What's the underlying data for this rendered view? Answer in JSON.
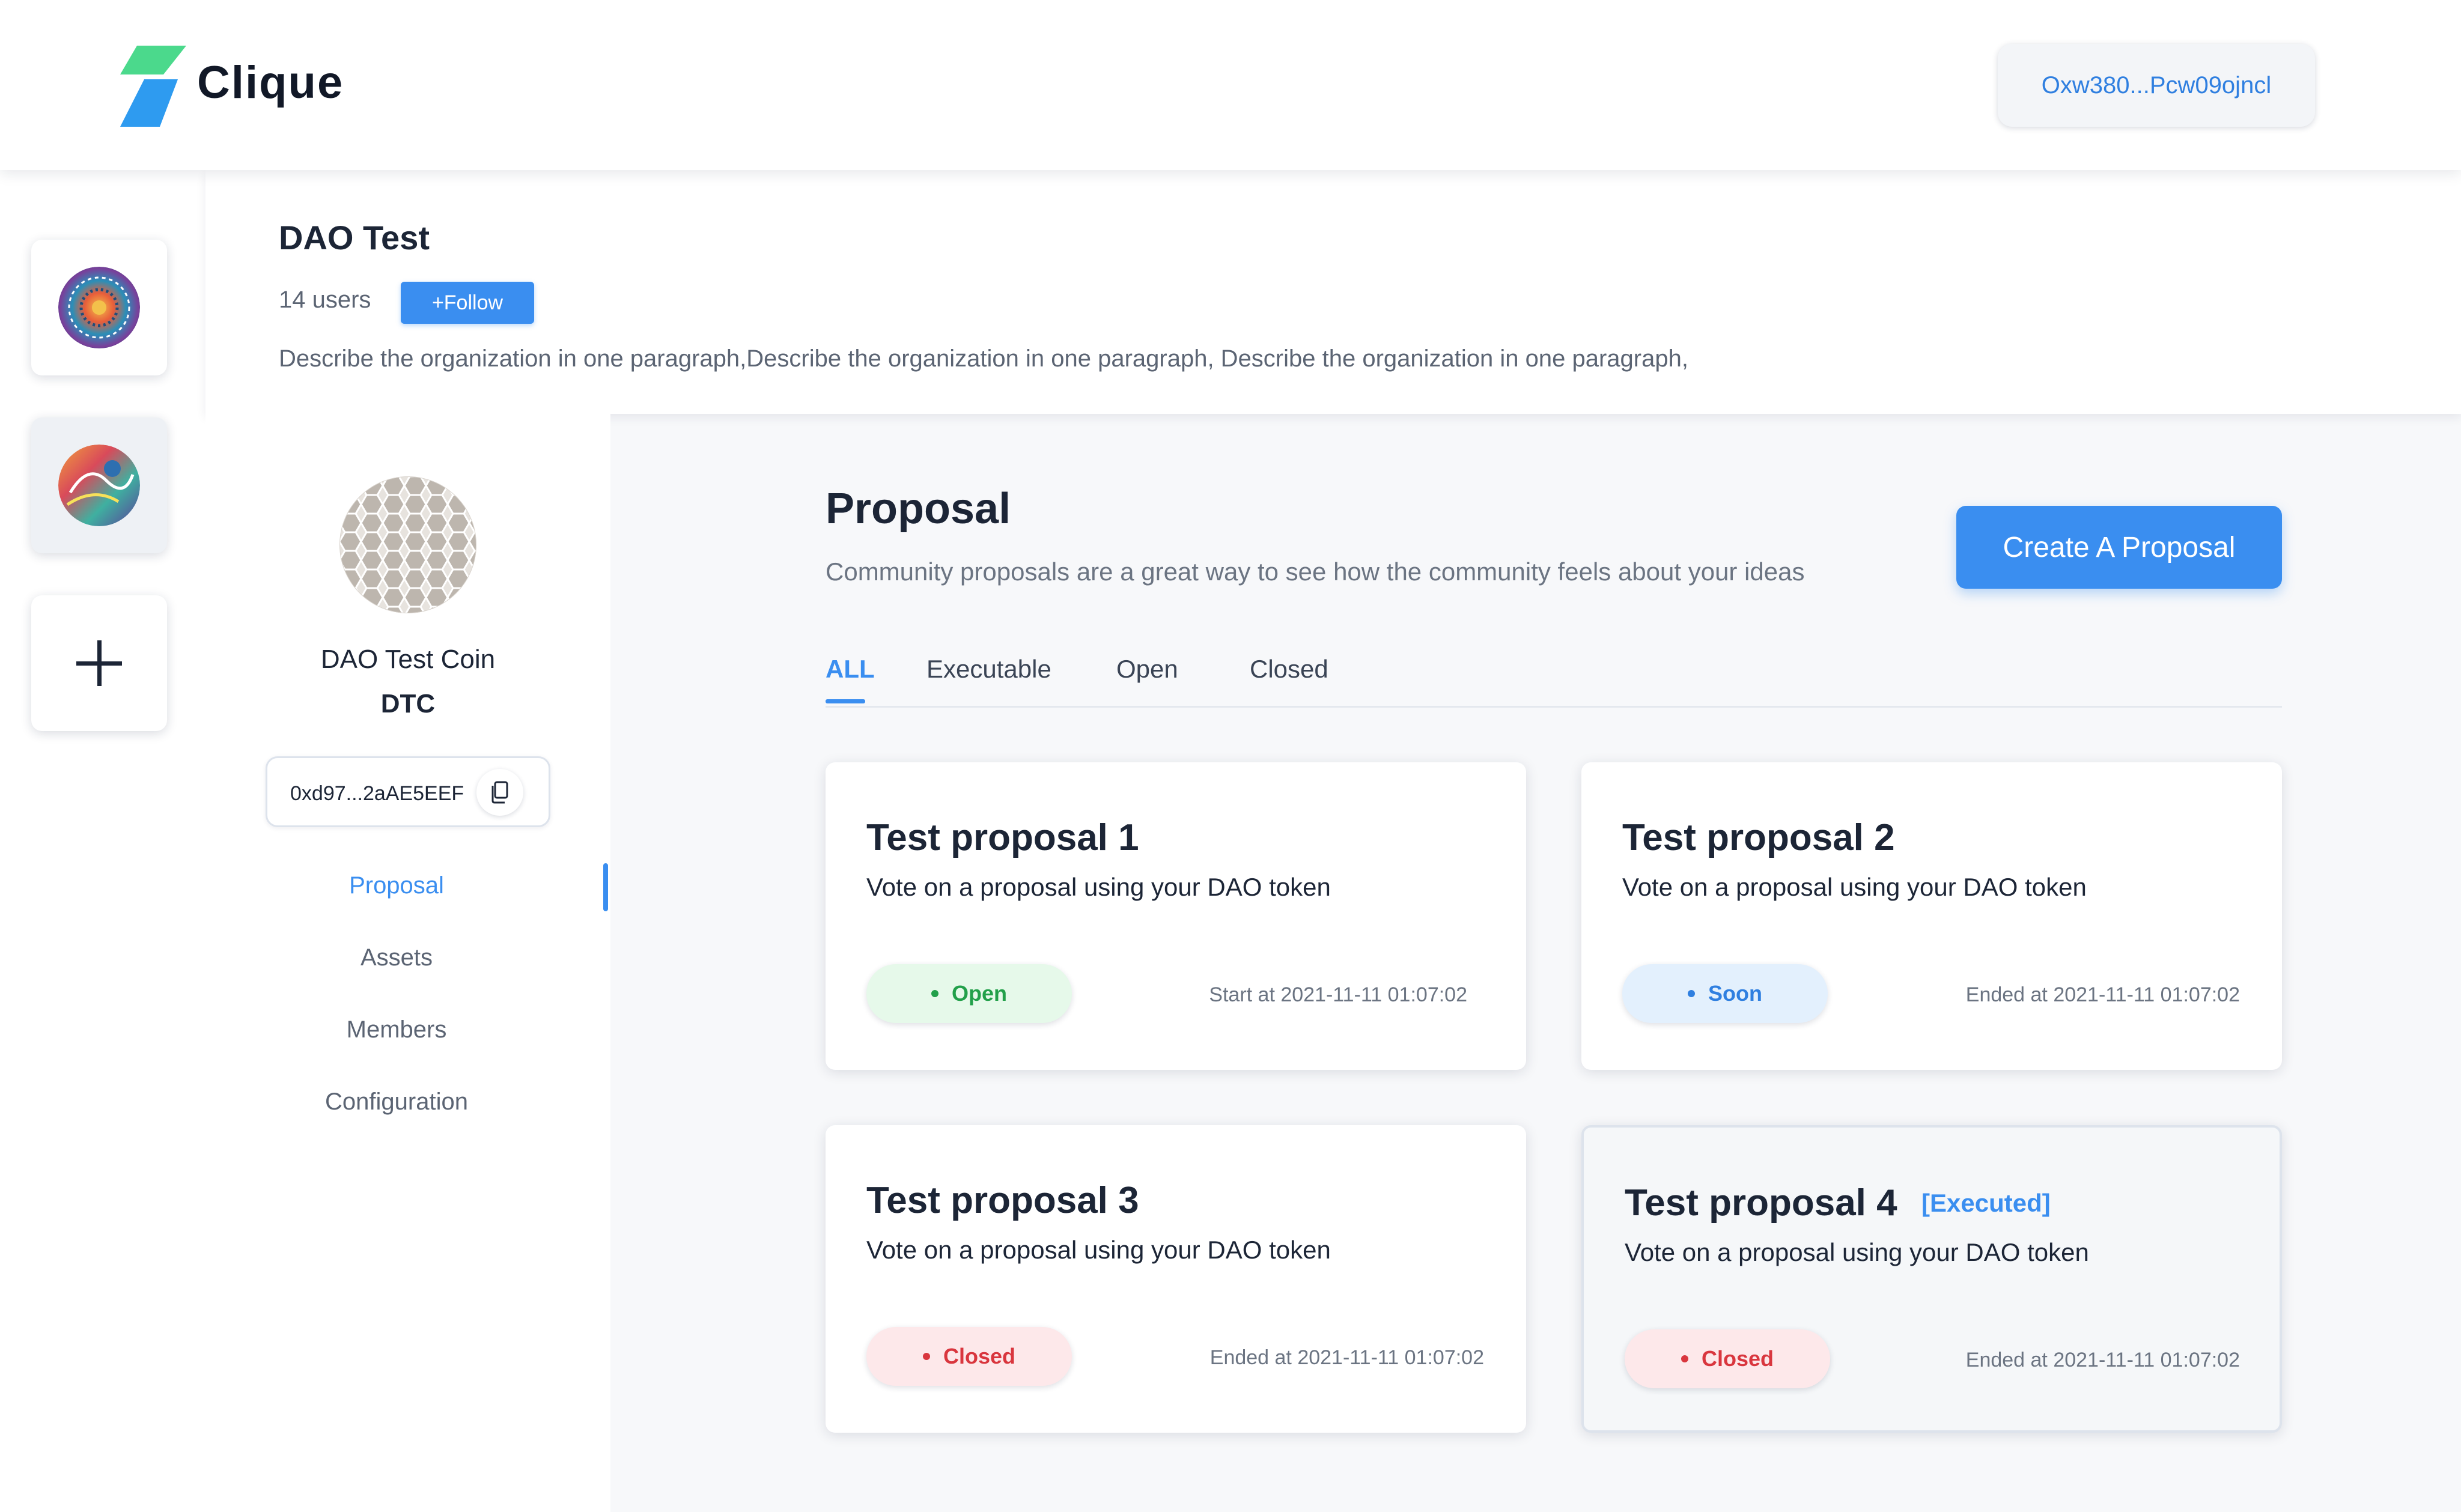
{
  "app": {
    "name": "Clique",
    "wallet_address": "Oxw380...Pcw09ojncl"
  },
  "dao": {
    "name": "DAO Test",
    "users": "14 users",
    "follow_label": "+Follow",
    "description": "Describe the organization in one paragraph,Describe the organization in one paragraph,  Describe the organization in one paragraph,"
  },
  "token": {
    "name": "DAO Test Coin",
    "symbol": "DTC",
    "address": "0xd97...2aAE5EEF"
  },
  "nav": {
    "items": [
      {
        "label": "Proposal",
        "active": true
      },
      {
        "label": "Assets",
        "active": false
      },
      {
        "label": "Members",
        "active": false
      },
      {
        "label": "Configuration",
        "active": false
      }
    ]
  },
  "main": {
    "title": "Proposal",
    "subtitle": "Community proposals are a great way to see how the community feels about your ideas",
    "create_label": "Create A Proposal",
    "tabs": [
      {
        "label": "ALL",
        "active": true
      },
      {
        "label": "Executable",
        "active": false
      },
      {
        "label": "Open",
        "active": false
      },
      {
        "label": "Closed",
        "active": false
      }
    ]
  },
  "proposals": [
    {
      "title": "Test proposal  1",
      "tag": "",
      "desc": "Vote on a proposal using your DAO token",
      "status": "Open",
      "time": "Start at 2021-11-11 01:07:02"
    },
    {
      "title": "Test proposal  2",
      "tag": "",
      "desc": "Vote on a proposal using your DAO token",
      "status": "Soon",
      "time": "Ended at 2021-11-11 01:07:02"
    },
    {
      "title": "Test proposal  3",
      "tag": "",
      "desc": "Vote on a proposal using your DAO token",
      "status": "Closed",
      "time": "Ended at 2021-11-11 01:07:02"
    },
    {
      "title": "Test proposal  4",
      "tag": "[Executed]",
      "desc": "Vote on a proposal using your DAO token",
      "status": "Closed",
      "time": "Ended at 2021-11-11 01:07:02"
    }
  ],
  "icons": {
    "logo": "clique-logo-icon",
    "add": "plus-icon",
    "copy": "copy-icon"
  },
  "colors": {
    "accent": "#3a8ef0",
    "open": "#22a04a",
    "soon": "#2f7fe0",
    "closed": "#d9363e"
  }
}
